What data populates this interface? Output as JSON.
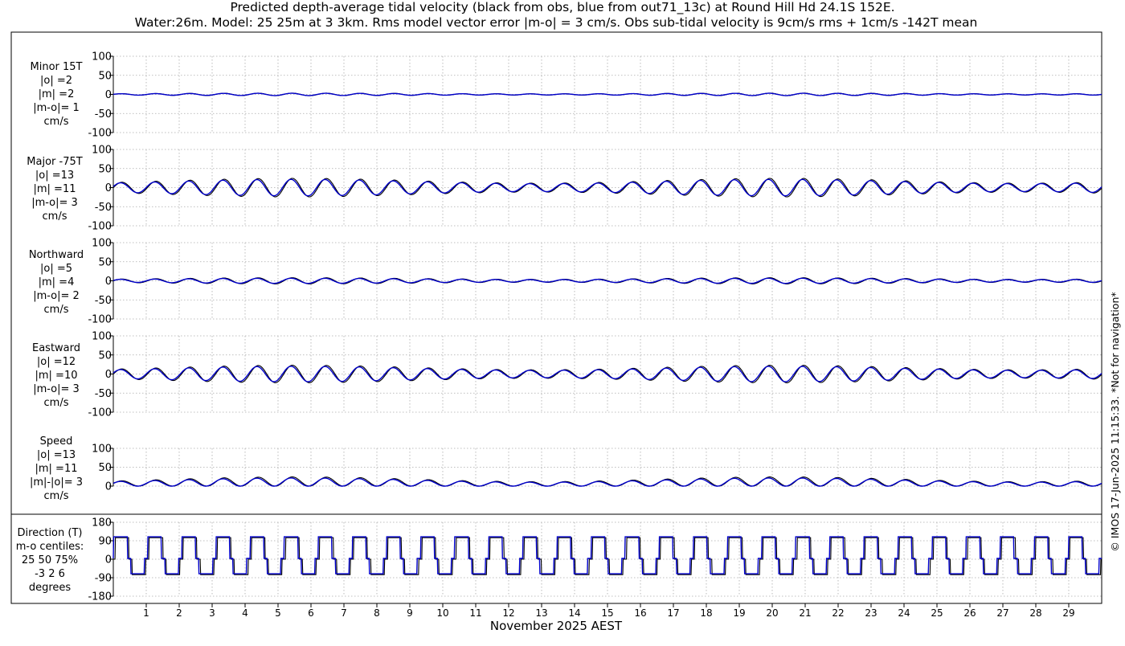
{
  "title": {
    "line1": "Predicted depth-average tidal velocity (black from obs, blue from out71_13c) at Round Hill Hd 24.1S 152E.",
    "line2": "Water:26m. Model: 25 25m at 3 3km. Rms model vector error |m-o| = 3 cm/s. Obs sub-tidal velocity is 9cm/s rms + 1cm/s -142T mean"
  },
  "xlabel": "November 2025 AEST",
  "footer": "© IMOS 17-Jun-2025 11:15:33. *Not for navigation*",
  "colors": {
    "obs": "#000000",
    "model": "#0000cc",
    "grid": "#aaaaaa"
  },
  "chart_data": [
    {
      "type": "line",
      "label_lines": [
        "Minor 15T",
        "|o| =2",
        "|m| =2",
        "|m-o|= 1",
        "cm/s"
      ],
      "ylim": [
        -100,
        100
      ],
      "yticks": [
        100,
        50,
        0,
        -50,
        -100
      ],
      "ytick_labels": [
        "100",
        "50",
        "0",
        "-50",
        "-100"
      ],
      "xlim": [
        0,
        30
      ],
      "xticks": [
        1,
        2,
        3,
        4,
        5,
        6,
        7,
        8,
        9,
        10,
        11,
        12,
        13,
        14,
        15,
        16,
        17,
        18,
        19,
        20,
        21,
        22,
        23,
        24,
        25,
        26,
        27,
        28,
        29
      ],
      "signal": {
        "kind": "tidal",
        "amp_obs": 2.5,
        "amp_model": 2.2,
        "phase_shift": 0.02
      },
      "series": [
        {
          "name": "obs"
        },
        {
          "name": "model"
        }
      ]
    },
    {
      "type": "line",
      "label_lines": [
        "Major -75T",
        "|o| =13",
        "|m| =11",
        "|m-o|= 3",
        "cm/s"
      ],
      "ylim": [
        -100,
        100
      ],
      "yticks": [
        100,
        50,
        0,
        -50,
        -100
      ],
      "ytick_labels": [
        "100",
        "50",
        "0",
        "-50",
        "-100"
      ],
      "xlim": [
        0,
        30
      ],
      "xticks": [
        1,
        2,
        3,
        4,
        5,
        6,
        7,
        8,
        9,
        10,
        11,
        12,
        13,
        14,
        15,
        16,
        17,
        18,
        19,
        20,
        21,
        22,
        23,
        24,
        25,
        26,
        27,
        28,
        29
      ],
      "signal": {
        "kind": "tidal",
        "amp_obs": 18,
        "amp_model": 16,
        "phase_shift": 0.04
      },
      "series": [
        {
          "name": "obs"
        },
        {
          "name": "model"
        }
      ]
    },
    {
      "type": "line",
      "label_lines": [
        "Northward",
        "|o| =5",
        "|m| =4",
        "|m-o|= 2",
        "cm/s"
      ],
      "ylim": [
        -100,
        100
      ],
      "yticks": [
        100,
        50,
        0,
        -50,
        -100
      ],
      "ytick_labels": [
        "100",
        "50",
        "0",
        "-50",
        "-100"
      ],
      "xlim": [
        0,
        30
      ],
      "xticks": [
        1,
        2,
        3,
        4,
        5,
        6,
        7,
        8,
        9,
        10,
        11,
        12,
        13,
        14,
        15,
        16,
        17,
        18,
        19,
        20,
        21,
        22,
        23,
        24,
        25,
        26,
        27,
        28,
        29
      ],
      "signal": {
        "kind": "tidal",
        "amp_obs": 6,
        "amp_model": 5,
        "phase_shift": 0.04
      },
      "series": [
        {
          "name": "obs"
        },
        {
          "name": "model"
        }
      ]
    },
    {
      "type": "line",
      "label_lines": [
        "Eastward",
        "|o| =12",
        "|m| =10",
        "|m-o|= 3",
        "cm/s"
      ],
      "ylim": [
        -100,
        100
      ],
      "yticks": [
        100,
        50,
        0,
        -50,
        -100
      ],
      "ytick_labels": [
        "100",
        "50",
        "0",
        "-50",
        "-100"
      ],
      "xlim": [
        0,
        30
      ],
      "xticks": [
        1,
        2,
        3,
        4,
        5,
        6,
        7,
        8,
        9,
        10,
        11,
        12,
        13,
        14,
        15,
        16,
        17,
        18,
        19,
        20,
        21,
        22,
        23,
        24,
        25,
        26,
        27,
        28,
        29
      ],
      "signal": {
        "kind": "tidal",
        "amp_obs": 17,
        "amp_model": 15,
        "phase_shift": 0.04
      },
      "series": [
        {
          "name": "obs"
        },
        {
          "name": "model"
        }
      ]
    },
    {
      "type": "line",
      "label_lines": [
        "Speed",
        "|o| =13",
        "|m| =11",
        "|m|-|o|= 3",
        "cm/s"
      ],
      "ylim": [
        0,
        100
      ],
      "yticks": [
        100,
        50,
        0
      ],
      "ytick_labels": [
        "100",
        "50",
        "0"
      ],
      "xlim": [
        0,
        30
      ],
      "xticks": [
        1,
        2,
        3,
        4,
        5,
        6,
        7,
        8,
        9,
        10,
        11,
        12,
        13,
        14,
        15,
        16,
        17,
        18,
        19,
        20,
        21,
        22,
        23,
        24,
        25,
        26,
        27,
        28,
        29
      ],
      "signal": {
        "kind": "speed",
        "amp_obs": 18,
        "amp_model": 16,
        "phase_shift": 0.04
      },
      "series": [
        {
          "name": "obs"
        },
        {
          "name": "model"
        }
      ]
    },
    {
      "type": "line",
      "label_lines": [
        "Direction (T)",
        "m-o centiles:",
        "25  50  75%",
        "-3  2  6",
        "degrees"
      ],
      "ylim": [
        -180,
        180
      ],
      "yticks": [
        180,
        90,
        0,
        -90,
        -180
      ],
      "ytick_labels": [
        "180",
        "90",
        "0",
        "-90",
        "-180"
      ],
      "xlim": [
        0,
        30
      ],
      "xticks": [
        1,
        2,
        3,
        4,
        5,
        6,
        7,
        8,
        9,
        10,
        11,
        12,
        13,
        14,
        15,
        16,
        17,
        18,
        19,
        20,
        21,
        22,
        23,
        24,
        25,
        26,
        27,
        28,
        29
      ],
      "signal": {
        "kind": "direction",
        "high": 105,
        "low": -75,
        "phase_shift": 0.04
      },
      "series": [
        {
          "name": "obs"
        },
        {
          "name": "model"
        }
      ]
    }
  ]
}
